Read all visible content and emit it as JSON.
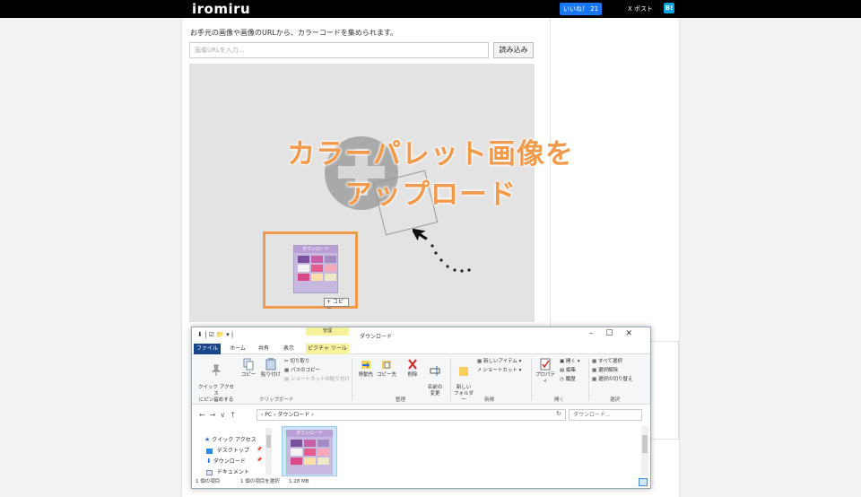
{
  "header": {
    "logo": "iromiru",
    "like_label": "いいね！ 21",
    "post_label": "X ポスト",
    "hatena_label": "B!"
  },
  "main": {
    "description": "お手元の画像や画像のURLから、カラーコードを集められます。",
    "url_placeholder": "画像URLを入力...",
    "load_button": "読み込み",
    "overlay_line1": "カラーパレット画像を",
    "overlay_line2": "アップロード"
  },
  "drag": {
    "thumb_label": "ダウンロード",
    "copy_label": "+ コピー",
    "swatch_colors": [
      "#7a4f9e",
      "#c85fa8",
      "#a58bc4",
      "#f3f3f3",
      "#e75b8e",
      "#f6a9b8",
      "#d84b86",
      "#fbe0a6",
      "#efe9c7"
    ]
  },
  "explorer": {
    "title": "ダウンロード",
    "context_tab": "管理",
    "tabs": [
      "ファイル",
      "ホーム",
      "共有",
      "表示",
      "ピクチャ ツール"
    ],
    "ribbon": {
      "quick_access": "クイック アクセス\nにピン留めする",
      "copy": "コピー",
      "paste": "貼り付け",
      "cut": "切り取り",
      "copy_path": "パスのコピー",
      "paste_shortcut": "ショートカットの貼り付け",
      "group_clipboard": "クリップボード",
      "move_to": "移動先",
      "copy_to": "コピー先",
      "delete": "削除",
      "rename": "名前の\n変更",
      "group_organize": "整理",
      "new_folder": "新しい\nフォルダー",
      "new_item": "新しいアイテム ▾",
      "shortcut": "ショートカット ▾",
      "group_new": "新規",
      "properties": "プロパティ",
      "open": "開く ▾",
      "edit": "編集",
      "history": "履歴",
      "group_open": "開く",
      "select_all": "すべて選択",
      "select_none": "選択解除",
      "invert_select": "選択の切り替え",
      "group_select": "選択"
    },
    "address": "›  PC  ›  ダウンロード  ›",
    "search_placeholder": "ダウンロード...",
    "nav": {
      "quick_access": "クイック アクセス",
      "desktop": "デスクトップ",
      "downloads": "ダウンロード",
      "documents": "ドキュメント"
    },
    "status": {
      "count": "1 個の項目",
      "selected": "1 個の項目を選択",
      "size": "1.28 MB"
    }
  },
  "colors": {
    "accent_orange": "#f29a4b",
    "facebook_blue": "#1877f2",
    "file_tab_blue": "#19478a"
  }
}
